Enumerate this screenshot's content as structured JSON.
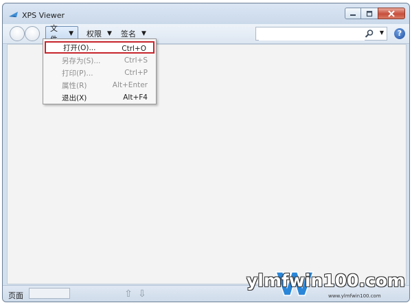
{
  "window": {
    "title": "XPS Viewer"
  },
  "toolbar": {
    "menus": [
      {
        "label": "文件"
      },
      {
        "label": "权限"
      },
      {
        "label": "签名"
      }
    ],
    "search": {
      "value": "",
      "placeholder": ""
    }
  },
  "file_menu": {
    "items": [
      {
        "label": "打开(O)...",
        "shortcut": "Ctrl+O",
        "enabled": true,
        "highlighted": true
      },
      {
        "label": "另存为(S)...",
        "shortcut": "Ctrl+S",
        "enabled": false,
        "highlighted": false
      },
      {
        "label": "打印(P)...",
        "shortcut": "Ctrl+P",
        "enabled": false,
        "highlighted": false
      },
      {
        "label": "属性(R)",
        "shortcut": "Alt+Enter",
        "enabled": false,
        "highlighted": false
      },
      {
        "label": "退出(X)",
        "shortcut": "Alt+F4",
        "enabled": true,
        "highlighted": false
      }
    ]
  },
  "statusbar": {
    "page_label": "页面",
    "page_value": ""
  },
  "watermark": {
    "text": "ylmfwin100.com",
    "sub": "www.ylmfwin100.com"
  },
  "colors": {
    "highlight_border": "#c7242b",
    "close_button": "#c74f3c",
    "accent": "#6d8db5"
  },
  "icons": {
    "app": "xps-viewer-icon",
    "search": "search-icon",
    "help": "help-icon"
  }
}
